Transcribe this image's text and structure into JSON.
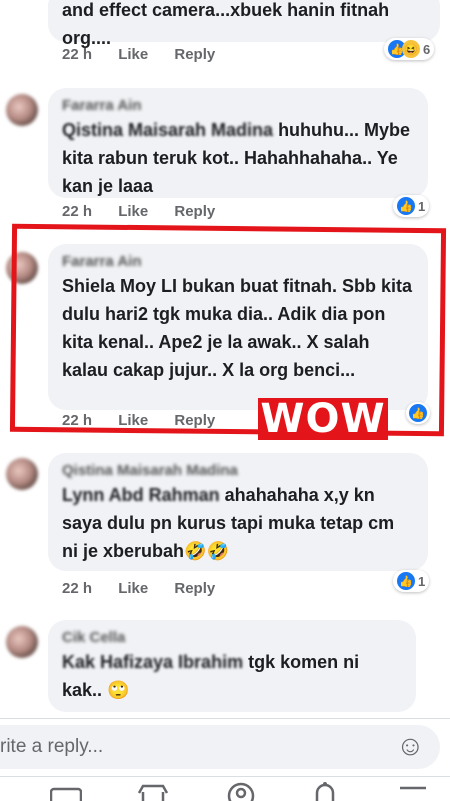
{
  "comments": [
    {
      "name": "",
      "text_tail": "and effect camera...xbuek hanin fitnah org....",
      "time": "22 h",
      "like": "Like",
      "reply": "Reply",
      "reaction_count": "6"
    },
    {
      "name": "Fararra Ain",
      "tag": "Qistina Maisarah Madina",
      "text": " huhuhu... Mybe kita rabun teruk kot.. Hahahhahaha.. Ye kan je laaa",
      "time": "22 h",
      "like": "Like",
      "reply": "Reply",
      "reaction_count": "1"
    },
    {
      "name": "Fararra Ain",
      "text": "Shiela Moy LI bukan buat fitnah. Sbb kita dulu hari2 tgk muka dia.. Adik dia pon kita kenal.. Ape2 je la awak.. X salah kalau cakap jujur.. X la org benci...",
      "time": "22 h",
      "like": "Like",
      "reply": "Reply"
    },
    {
      "name": "Qistina Maisarah Madina",
      "tag": "Lynn Abd Rahman",
      "text": " ahahahaha x,y kn saya dulu pn kurus tapi muka tetap cm ni je xberubah🤣🤣",
      "time": "22 h",
      "like": "Like",
      "reply": "Reply",
      "reaction_count": "1"
    },
    {
      "name": "Cik Cella",
      "tag": "Kak Hafizaya Ibrahim",
      "text": " tgk komen ni kak.. 🙄"
    }
  ],
  "overlay": {
    "wow_label": "WOW"
  },
  "reply_bar": {
    "placeholder": "rite a reply...",
    "emoji": "☺"
  },
  "colors": {
    "highlight": "#e3151a",
    "facebook_blue": "#1877f2"
  }
}
